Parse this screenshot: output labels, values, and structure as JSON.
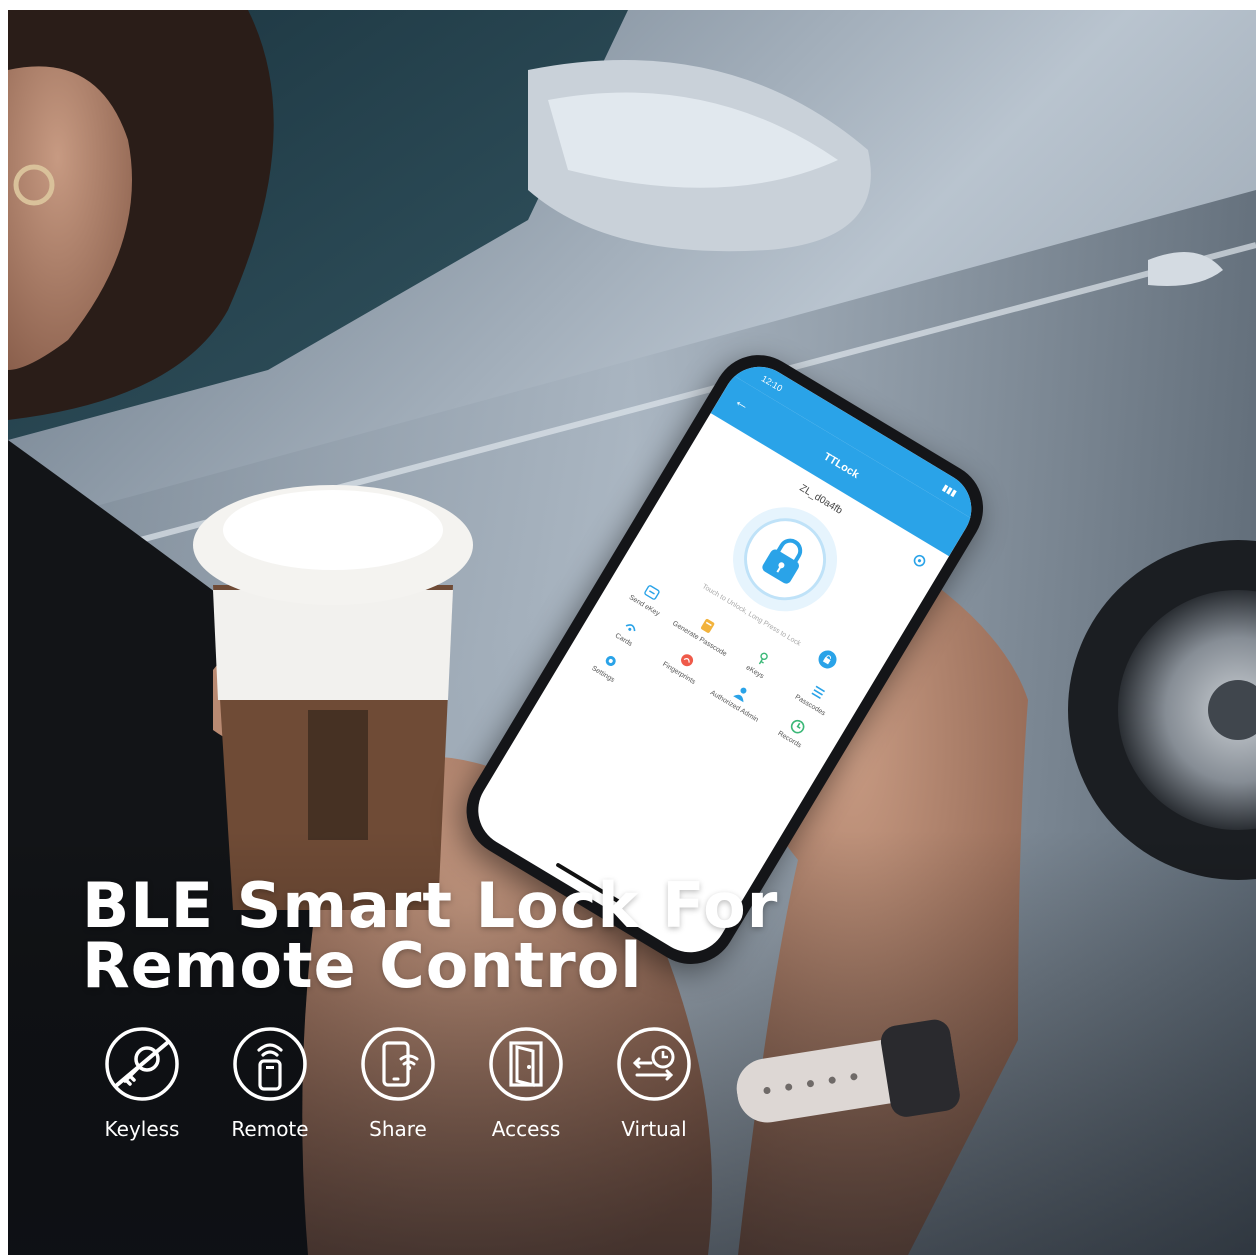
{
  "headline": {
    "line1": "BLE Smart Lock For",
    "line2": "Remote Control"
  },
  "features": [
    {
      "label": "Keyless",
      "icon": "keyless-icon"
    },
    {
      "label": "Remote",
      "icon": "remote-icon"
    },
    {
      "label": "Share",
      "icon": "share-icon"
    },
    {
      "label": "Access",
      "icon": "access-icon"
    },
    {
      "label": "Virtual",
      "icon": "virtual-icon"
    }
  ],
  "phone_app": {
    "status_time": "12:10",
    "title": "TTLock",
    "lock_name": "ZL_d0a4fb",
    "hint": "Touch to Unlock, Long Press to Lock",
    "menu": [
      {
        "label": "Send eKey",
        "icon": "send-ekey-icon"
      },
      {
        "label": "Generate Passcode",
        "icon": "passcode-icon"
      },
      {
        "label": "eKeys",
        "icon": "ekeys-icon"
      },
      {
        "label": "Passcodes",
        "icon": "passcodes-list-icon"
      },
      {
        "label": "Cards",
        "icon": "cards-icon"
      },
      {
        "label": "Fingerprints",
        "icon": "fingerprint-icon"
      },
      {
        "label": "Authorized Admin",
        "icon": "admin-icon"
      },
      {
        "label": "Records",
        "icon": "records-icon"
      },
      {
        "label": "Settings",
        "icon": "settings-icon"
      }
    ]
  },
  "colors": {
    "app_accent": "#2aa3e8",
    "headline": "#ffffff",
    "car_body": "#b8c3cf"
  }
}
